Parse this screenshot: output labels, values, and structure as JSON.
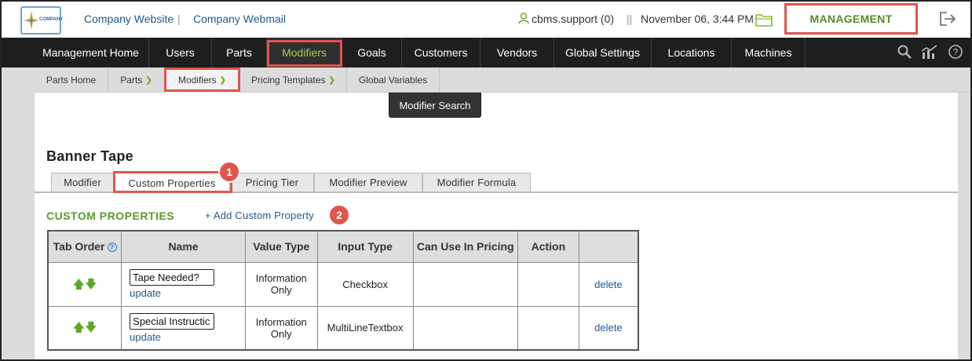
{
  "header": {
    "logo_text": "COMPANY",
    "links": [
      "Company Website",
      "Company Webmail"
    ],
    "separator": "|",
    "user": "cbms.support (0)",
    "user_separator": "||",
    "datetime": "November 06, 3:44 PM",
    "management_label": "MANAGEMENT"
  },
  "main_nav": {
    "items": [
      "Management Home",
      "Users",
      "Parts",
      "Modifiers",
      "Goals",
      "Customers",
      "Vendors",
      "Global Settings",
      "Locations",
      "Machines"
    ],
    "active": "Modifiers"
  },
  "sub_nav": {
    "items": [
      "Parts Home",
      "Parts",
      "Modifiers",
      "Pricing Templates",
      "Global Variables"
    ],
    "active": "Modifiers",
    "dropdown_item": "Modifier Search"
  },
  "page": {
    "title": "Banner Tape",
    "tabs": [
      "Modifier",
      "Custom Properties",
      "Pricing Tier",
      "Modifier Preview",
      "Modifier Formula"
    ],
    "active_tab": "Custom Properties",
    "badge_1": "1",
    "badge_2": "2"
  },
  "custom_properties": {
    "section_title": "CUSTOM PROPERTIES",
    "add_label": "+ Add Custom Property",
    "columns": [
      "Tab Order",
      "Name",
      "Value Type",
      "Input Type",
      "Can Use In Pricing",
      "Action",
      ""
    ],
    "rows": [
      {
        "name": "Tape Needed?",
        "update": "update",
        "value_type": "Information Only",
        "input_type": "Checkbox",
        "can_use": "",
        "action": "",
        "delete": "delete"
      },
      {
        "name": "Special Instructic",
        "update": "update",
        "value_type": "Information Only",
        "input_type": "MultiLineTextbox",
        "can_use": "",
        "action": "",
        "delete": "delete"
      }
    ]
  },
  "colors": {
    "highlight": "#e0554e",
    "accent_green": "#5a9a2a",
    "nav_bg": "#1e1e1e",
    "link_blue": "#1f5a8a"
  }
}
